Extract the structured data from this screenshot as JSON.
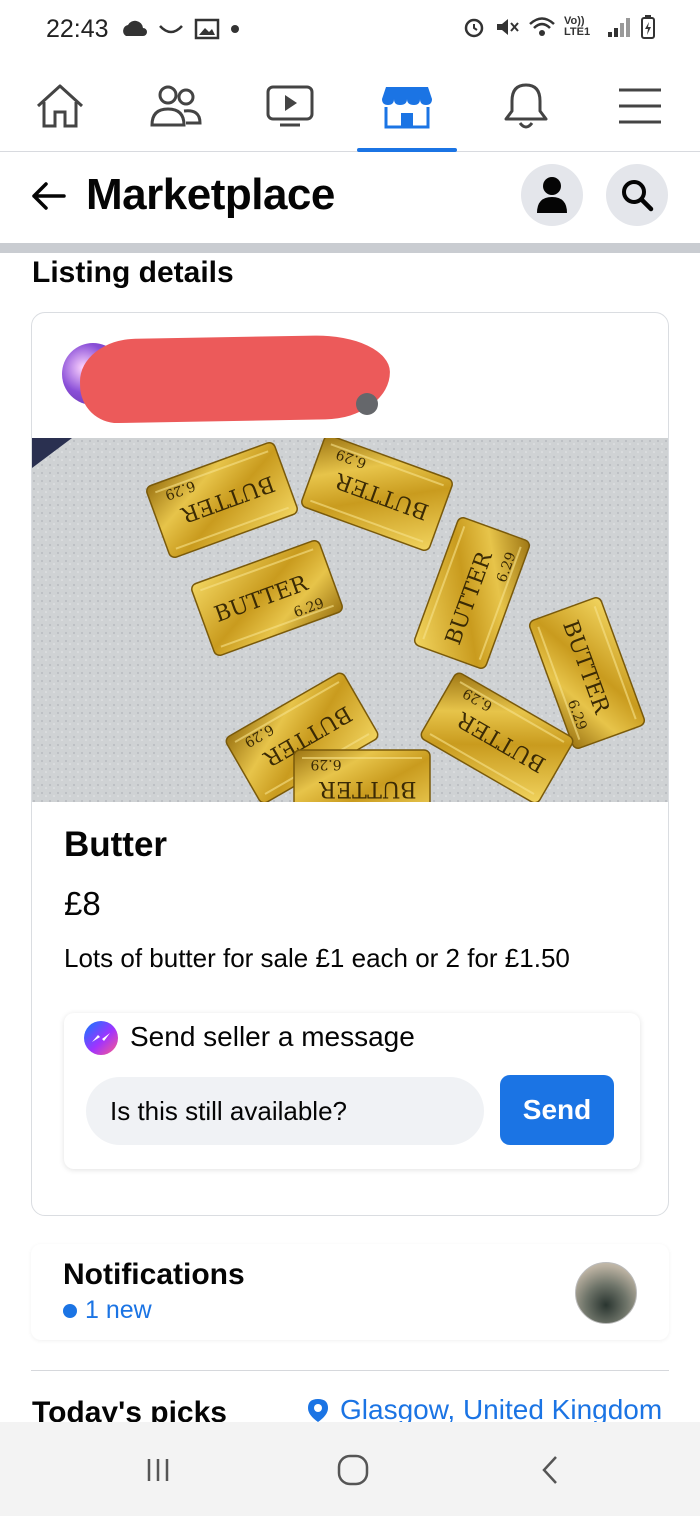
{
  "status_bar": {
    "time": "22:43",
    "network_label": "Vo)) LTE1"
  },
  "nav": {
    "tabs": [
      {
        "icon": "home-icon"
      },
      {
        "icon": "friends-icon"
      },
      {
        "icon": "watch-icon"
      },
      {
        "icon": "marketplace-icon",
        "active": true
      },
      {
        "icon": "bell-icon"
      },
      {
        "icon": "menu-icon"
      }
    ],
    "accent": "#1b74e4"
  },
  "header": {
    "title": "Marketplace"
  },
  "section_heading": "Listing details",
  "listing": {
    "title": "Butter",
    "price": "£8",
    "description": "Lots of butter for sale £1 each or 2 for £1.50",
    "message": {
      "label": "Send seller a message",
      "input_value": "Is this still available?",
      "send_label": "Send"
    },
    "photo_packet_label": "BUTTER",
    "photo_packet_weight": "6.29"
  },
  "notifications": {
    "title": "Notifications",
    "new_count": "1 new"
  },
  "todays_picks": {
    "title": "Today's picks",
    "location": "Glasgow, United Kingdom"
  },
  "colors": {
    "brand": "#1b74e4",
    "redaction": "#ec5a5a",
    "butter_gold": "#d4ae2c"
  }
}
